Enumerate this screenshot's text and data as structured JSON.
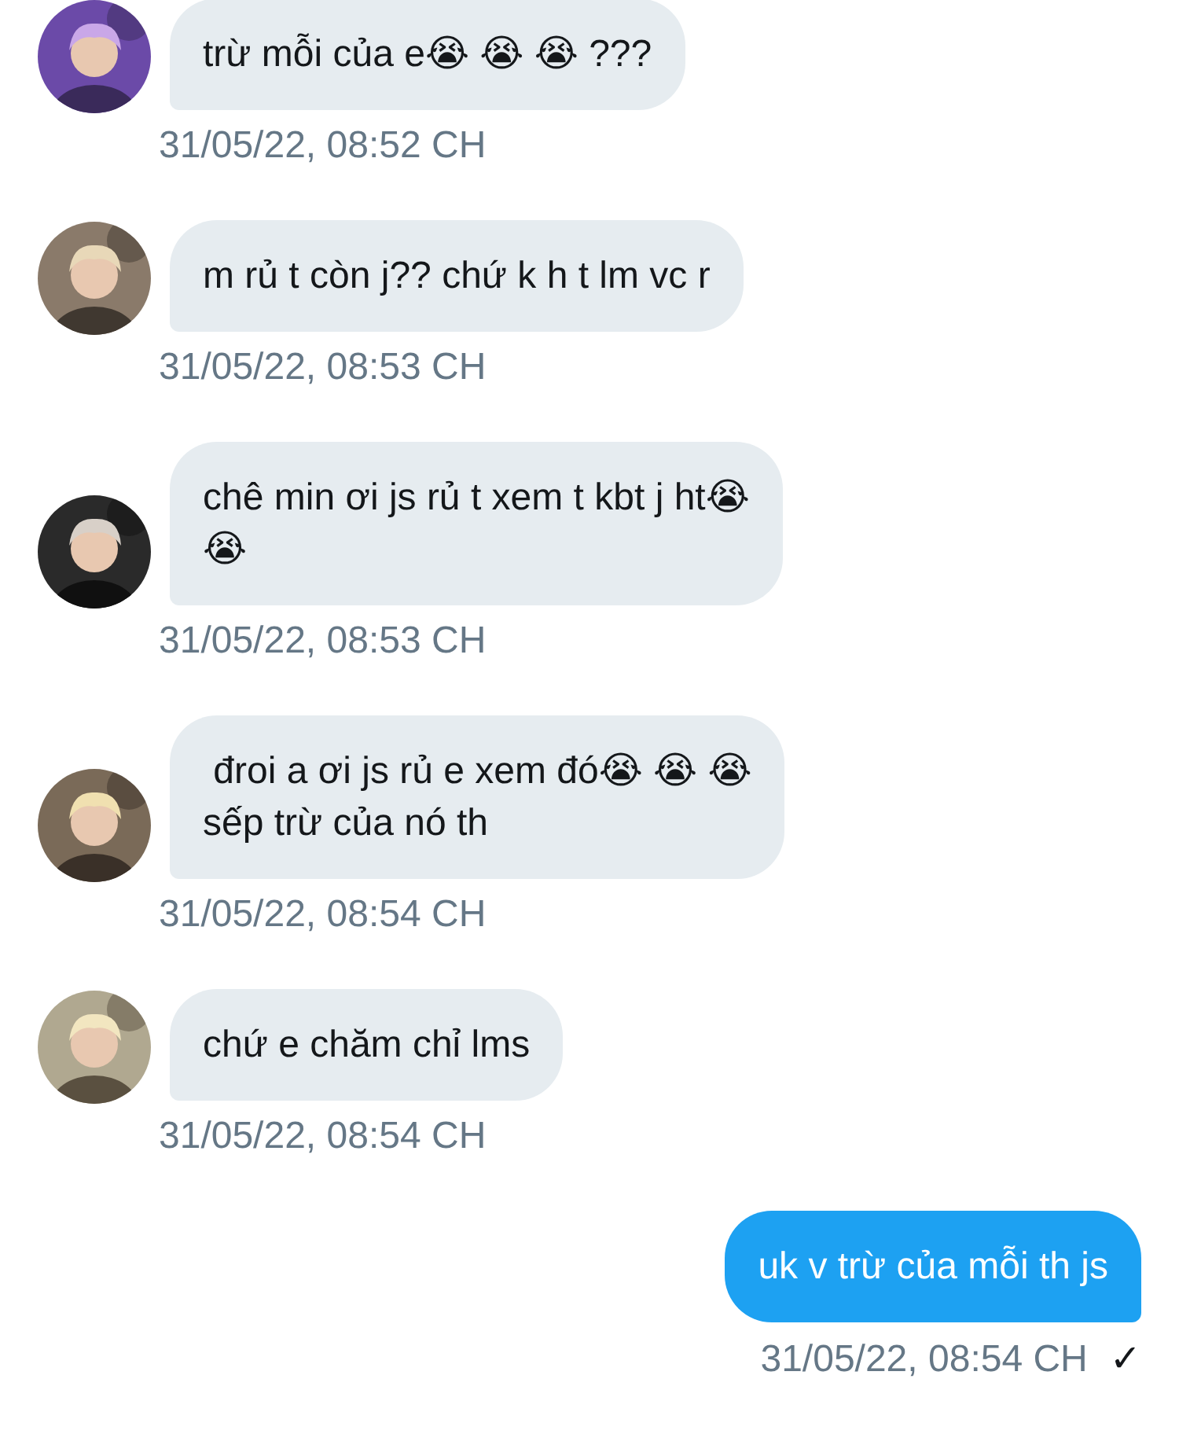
{
  "messages": [
    {
      "kind": "received",
      "avatar": {
        "kind": "picture"
      },
      "lines": [
        "trừ mỗi của e😭 😭 😭 ???"
      ],
      "time": "31/05/22, 08:52 CH"
    },
    {
      "kind": "received",
      "avatar": {
        "kind": "picture"
      },
      "lines": [
        "m rủ t còn j?? chứ k h t lm vc r"
      ],
      "time": "31/05/22, 08:53 CH"
    },
    {
      "kind": "received",
      "avatar": {
        "kind": "picture"
      },
      "lines": [
        "chê min ơi js rủ t xem t kbt j ht😭",
        "😭"
      ],
      "time": "31/05/22, 08:53 CH"
    },
    {
      "kind": "received",
      "avatar": {
        "kind": "picture"
      },
      "lines": [
        " đroi a ơi js rủ e xem đó😭 😭 😭",
        "sếp trừ của nó th"
      ],
      "time": "31/05/22, 08:54 CH"
    },
    {
      "kind": "received",
      "avatar": {
        "kind": "picture"
      },
      "lines": [
        "chứ e chăm chỉ lms"
      ],
      "time": "31/05/22, 08:54 CH"
    },
    {
      "kind": "sent",
      "lines": [
        "uk v trừ của mỗi th js"
      ],
      "time": "31/05/22, 08:54 CH",
      "receipt": "✓"
    }
  ]
}
